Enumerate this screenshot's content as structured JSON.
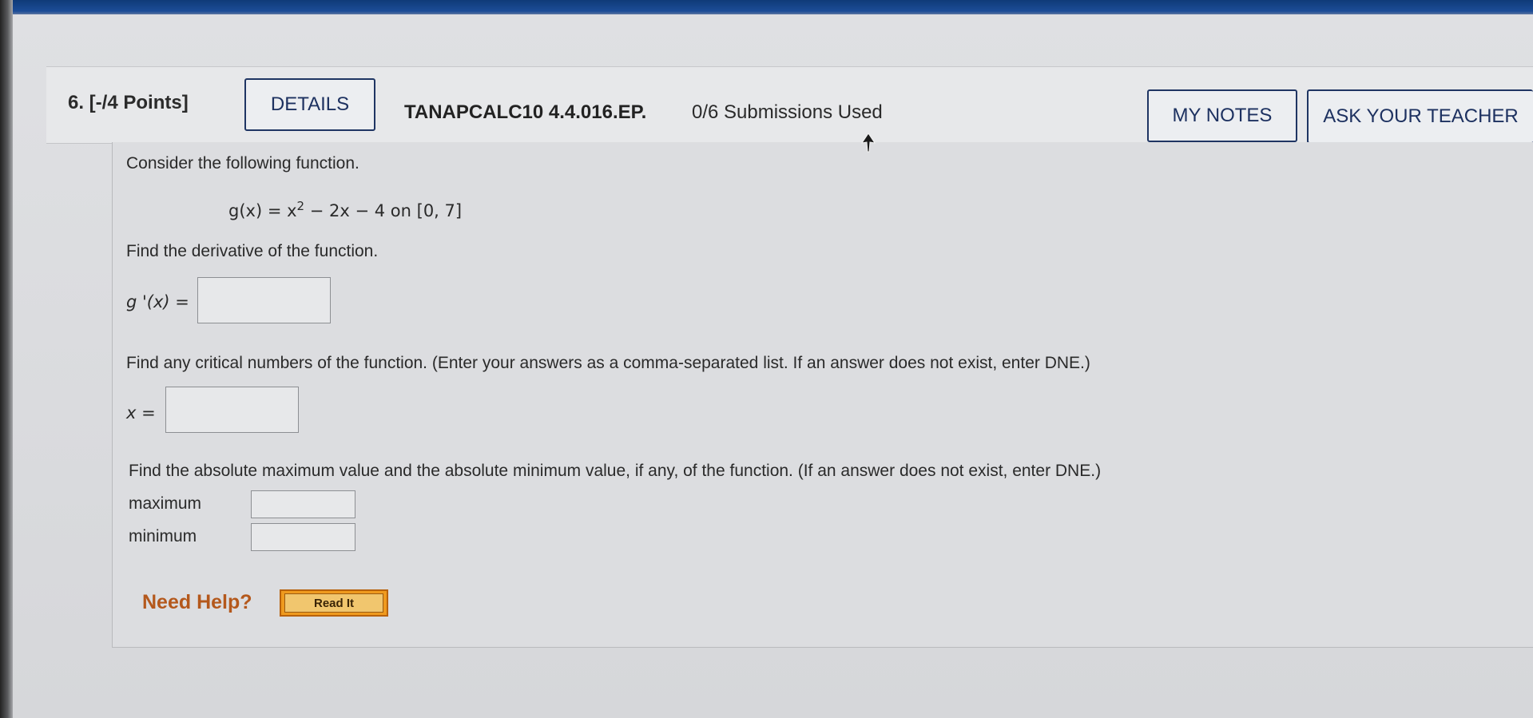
{
  "question": {
    "number_points": "6. [-/4 Points]",
    "details_label": "DETAILS",
    "course_code": "TANAPCALC10 4.4.016.EP.",
    "submissions": "0/6 Submissions Used",
    "my_notes_label": "MY NOTES",
    "ask_teacher_label": "ASK YOUR TEACHER"
  },
  "body": {
    "intro": "Consider the following function.",
    "function": {
      "lhs": "g(x) = x",
      "exponent": "2",
      "rhs": " − 2x − 4 on [0, 7]"
    },
    "derivative_prompt": "Find the derivative of the function.",
    "derivative_label": "g '(x) =",
    "derivative_value": "",
    "critical_prompt": "Find any critical numbers of the function. (Enter your answers as a comma-separated list. If an answer does not exist, enter DNE.)",
    "critical_label": "x =",
    "critical_value": "",
    "extrema_prompt": "Find the absolute maximum value and the absolute minimum value, if any, of the function. (If an answer does not exist, enter DNE.)",
    "maximum_label": "maximum",
    "maximum_value": "",
    "minimum_label": "minimum",
    "minimum_value": ""
  },
  "help": {
    "label": "Need Help?",
    "read_it_label": "Read It"
  },
  "icons": [
    "mouse-cursor-icon"
  ],
  "colors": {
    "accent": "#1f3563",
    "help_orange": "#b4581c",
    "read_it_button": "#ef9a1e"
  }
}
